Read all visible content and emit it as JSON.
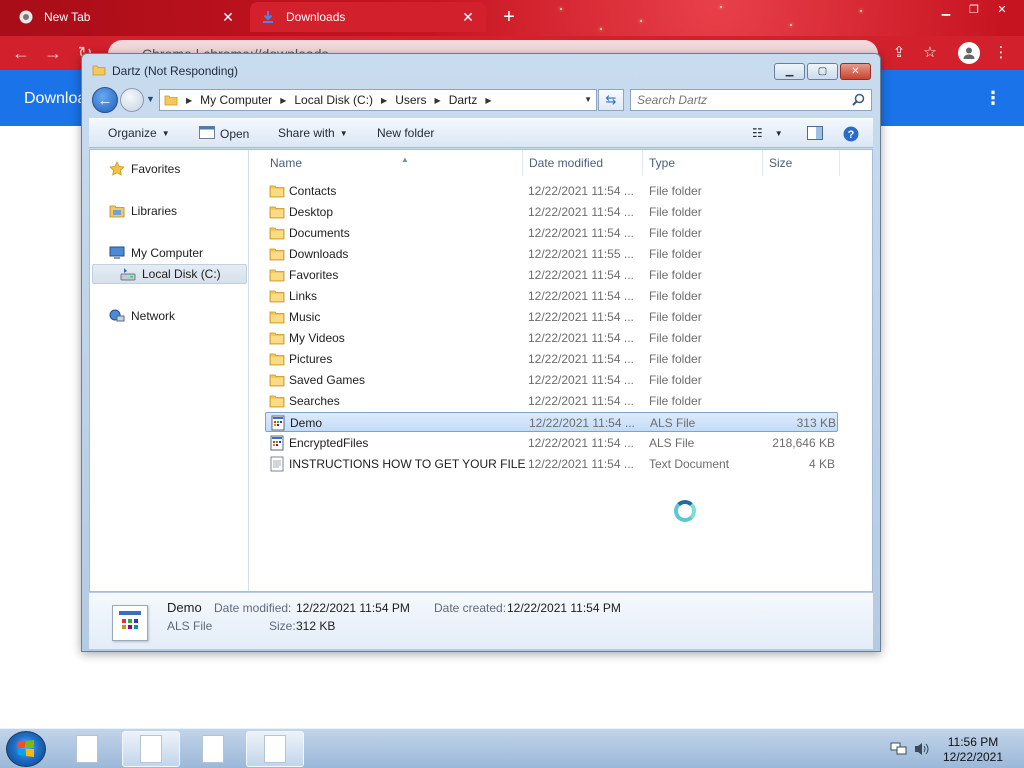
{
  "browser": {
    "tabs": [
      {
        "title": "New Tab",
        "icon": "chrome-icon",
        "active": false
      },
      {
        "title": "Downloads",
        "icon": "download-icon",
        "active": true
      }
    ],
    "omnibox": {
      "text": "Chrome  |  chrome://downloads"
    },
    "page_title": "Downloads",
    "theme_color": "#d3202d",
    "header_color": "#1a73e8"
  },
  "explorer": {
    "title": "Dartz (Not Responding)",
    "breadcrumb": [
      "My Computer",
      "Local Disk (C:)",
      "Users",
      "Dartz"
    ],
    "search_placeholder": "Search Dartz",
    "commands": {
      "organize": "Organize",
      "open": "Open",
      "share_with": "Share with",
      "new_folder": "New folder"
    },
    "nav": {
      "favorites": "Favorites",
      "libraries": "Libraries",
      "my_computer": "My Computer",
      "local_disk": "Local Disk (C:)",
      "network": "Network"
    },
    "columns": {
      "name": "Name",
      "date": "Date modified",
      "type": "Type",
      "size": "Size"
    },
    "files": [
      {
        "name": "Contacts",
        "date": "12/22/2021 11:54 ...",
        "type": "File folder",
        "size": "",
        "icon": "folder-contacts-icon"
      },
      {
        "name": "Desktop",
        "date": "12/22/2021 11:54 ...",
        "type": "File folder",
        "size": "",
        "icon": "folder-desktop-icon"
      },
      {
        "name": "Documents",
        "date": "12/22/2021 11:54 ...",
        "type": "File folder",
        "size": "",
        "icon": "folder-documents-icon"
      },
      {
        "name": "Downloads",
        "date": "12/22/2021 11:55 ...",
        "type": "File folder",
        "size": "",
        "icon": "folder-downloads-icon"
      },
      {
        "name": "Favorites",
        "date": "12/22/2021 11:54 ...",
        "type": "File folder",
        "size": "",
        "icon": "folder-favorites-icon"
      },
      {
        "name": "Links",
        "date": "12/22/2021 11:54 ...",
        "type": "File folder",
        "size": "",
        "icon": "folder-links-icon"
      },
      {
        "name": "Music",
        "date": "12/22/2021 11:54 ...",
        "type": "File folder",
        "size": "",
        "icon": "folder-music-icon"
      },
      {
        "name": "My Videos",
        "date": "12/22/2021 11:54 ...",
        "type": "File folder",
        "size": "",
        "icon": "folder-videos-icon"
      },
      {
        "name": "Pictures",
        "date": "12/22/2021 11:54 ...",
        "type": "File folder",
        "size": "",
        "icon": "folder-pictures-icon"
      },
      {
        "name": "Saved Games",
        "date": "12/22/2021 11:54 ...",
        "type": "File folder",
        "size": "",
        "icon": "folder-games-icon"
      },
      {
        "name": "Searches",
        "date": "12/22/2021 11:54 ...",
        "type": "File folder",
        "size": "",
        "icon": "folder-searches-icon"
      },
      {
        "name": "Demo",
        "date": "12/22/2021 11:54 ...",
        "type": "ALS File",
        "size": "313 KB",
        "icon": "als-file-icon",
        "selected": true
      },
      {
        "name": "EncryptedFiles",
        "date": "12/22/2021 11:54 ...",
        "type": "ALS File",
        "size": "218,646 KB",
        "icon": "als-file-icon"
      },
      {
        "name": "INSTRUCTIONS HOW TO GET YOUR FILE...",
        "date": "12/22/2021 11:54 ...",
        "type": "Text Document",
        "size": "4 KB",
        "icon": "text-document-icon"
      }
    ],
    "details": {
      "name": "Demo",
      "type": "ALS File",
      "date_modified_label": "Date modified:",
      "date_modified": "12/22/2021 11:54 PM",
      "date_created_label": "Date created:",
      "date_created": "12/22/2021 11:54 PM",
      "size_label": "Size:",
      "size": "312 KB"
    }
  },
  "taskbar": {
    "time": "11:56 PM",
    "date": "12/22/2021"
  }
}
